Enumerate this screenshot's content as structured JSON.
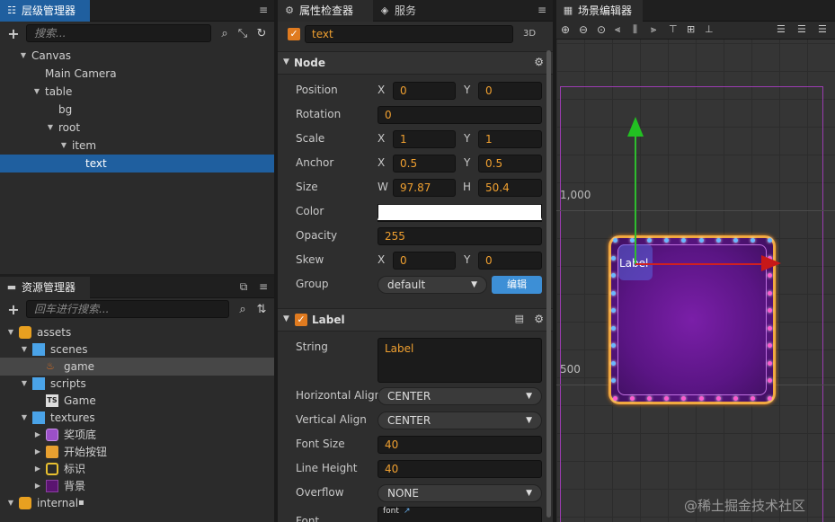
{
  "hierarchy": {
    "title": "层级管理器",
    "search_placeholder": "搜索...",
    "nodes": [
      {
        "label": "Canvas",
        "depth": 0,
        "expanded": true
      },
      {
        "label": "Main Camera",
        "depth": 1,
        "expanded": null
      },
      {
        "label": "table",
        "depth": 1,
        "expanded": true
      },
      {
        "label": "bg",
        "depth": 2,
        "expanded": null
      },
      {
        "label": "root",
        "depth": 2,
        "expanded": true
      },
      {
        "label": "item",
        "depth": 3,
        "expanded": true
      },
      {
        "label": "text",
        "depth": 4,
        "expanded": null,
        "selected": true
      }
    ]
  },
  "assets": {
    "title": "资源管理器",
    "search_placeholder": "回车进行搜索...",
    "items": [
      {
        "label": "assets",
        "depth": 0,
        "icon": "database-icon"
      },
      {
        "label": "scenes",
        "depth": 1,
        "icon": "folder-icon"
      },
      {
        "label": "game",
        "depth": 2,
        "icon": "scene-flame-icon",
        "highlight": true
      },
      {
        "label": "scripts",
        "depth": 1,
        "icon": "folder-icon"
      },
      {
        "label": "Game",
        "depth": 2,
        "icon": "typescript-icon"
      },
      {
        "label": "textures",
        "depth": 1,
        "icon": "folder-icon"
      },
      {
        "label": "奖项底",
        "depth": 2,
        "icon": "texture-purple-icon"
      },
      {
        "label": "开始按钮",
        "depth": 2,
        "icon": "texture-orange-icon"
      },
      {
        "label": "标识",
        "depth": 2,
        "icon": "texture-frame-icon"
      },
      {
        "label": "背景",
        "depth": 2,
        "icon": "texture-dark-icon"
      },
      {
        "label": "internal",
        "depth": 0,
        "icon": "database-icon",
        "locked": true
      }
    ]
  },
  "inspector": {
    "tab_label": "属性检查器",
    "tab2_label": "服务",
    "node_name": "text",
    "mode_label": "3D",
    "node_section": "Node",
    "props": {
      "position": {
        "label": "Position",
        "x": "0",
        "y": "0"
      },
      "rotation": {
        "label": "Rotation",
        "value": "0"
      },
      "scale": {
        "label": "Scale",
        "x": "1",
        "y": "1"
      },
      "anchor": {
        "label": "Anchor",
        "x": "0.5",
        "y": "0.5"
      },
      "size": {
        "label": "Size",
        "w": "97.87",
        "h": "50.4"
      },
      "color": {
        "label": "Color",
        "value": "#ffffff"
      },
      "opacity": {
        "label": "Opacity",
        "value": "255"
      },
      "skew": {
        "label": "Skew",
        "x": "0",
        "y": "0"
      },
      "group": {
        "label": "Group",
        "value": "default",
        "edit_button": "编辑"
      }
    },
    "axis_labels": {
      "x": "X",
      "y": "Y",
      "w": "W",
      "h": "H"
    },
    "label_section": "Label",
    "label_props": {
      "string": {
        "label": "String",
        "value": "Label"
      },
      "halign": {
        "label": "Horizontal Align",
        "value": "CENTER"
      },
      "valign": {
        "label": "Vertical Align",
        "value": "CENTER"
      },
      "font_size": {
        "label": "Font Size",
        "value": "40"
      },
      "line_height": {
        "label": "Line Height",
        "value": "40"
      },
      "overflow": {
        "label": "Overflow",
        "value": "NONE"
      },
      "font": {
        "label": "Font",
        "tag": "font"
      }
    }
  },
  "scene": {
    "title": "场景编辑器",
    "ruler_labels": [
      "1,000",
      "500"
    ],
    "node_text": "Label",
    "watermark": "@稀土掘金技术社区"
  },
  "colors": {
    "accent_orange": "#e07b20",
    "selection_blue": "#1f5f9f",
    "value_orange": "#f0a030",
    "button_blue": "#3d8fd6"
  }
}
